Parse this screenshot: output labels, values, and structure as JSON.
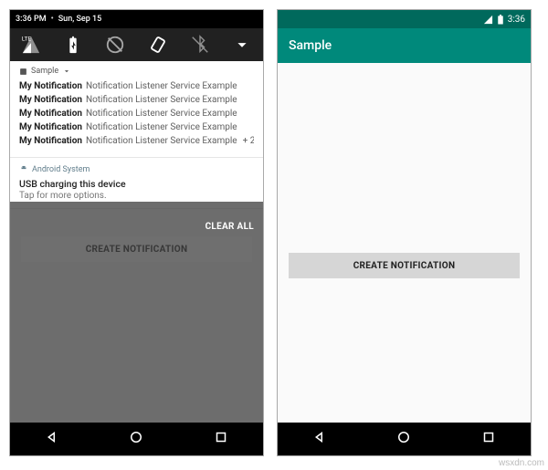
{
  "left": {
    "status": {
      "time": "3:36 PM",
      "date": "Sun, Sep 15"
    },
    "toggles": [
      "lte-icon",
      "battery-charging-icon",
      "grayscale-icon",
      "rotate-icon",
      "bluetooth-off-icon",
      "chevron-down-icon"
    ],
    "notif": {
      "app_name": "Sample",
      "rows": [
        {
          "title": "My Notification",
          "body": "Notification Listener Service Example"
        },
        {
          "title": "My Notification",
          "body": "Notification Listener Service Example"
        },
        {
          "title": "My Notification",
          "body": "Notification Listener Service Example"
        },
        {
          "title": "My Notification",
          "body": "Notification Listener Service Example"
        },
        {
          "title": "My Notification",
          "body": "Notification Listener Service Example"
        }
      ],
      "overflow": "+ 2"
    },
    "system": {
      "label": "Android System",
      "title": "USB charging this device",
      "subtitle": "Tap for more options."
    },
    "clear_all": "CLEAR ALL",
    "button": "CREATE NOTIFICATION"
  },
  "right": {
    "status": {
      "time": "3:36"
    },
    "app_bar": {
      "title": "Sample"
    },
    "button": "CREATE NOTIFICATION"
  },
  "watermark": "wsxdn.com"
}
